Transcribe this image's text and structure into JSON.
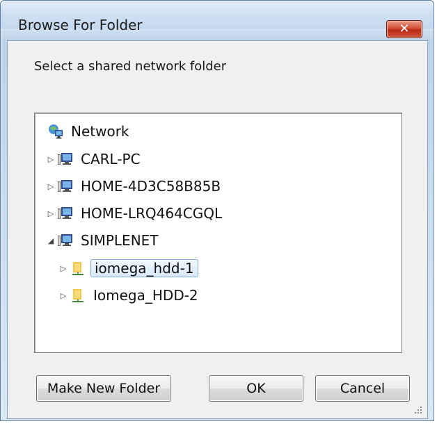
{
  "window": {
    "title": "Browse For Folder",
    "close_glyph": "✕"
  },
  "dialog": {
    "prompt": "Select a shared network folder"
  },
  "tree": {
    "root": {
      "label": "Network",
      "icon": "network-globe-icon"
    },
    "items": [
      {
        "label": "CARL-PC",
        "expander": "▷",
        "icon": "computer-icon"
      },
      {
        "label": "HOME-4D3C58B85B",
        "expander": "▷",
        "icon": "computer-icon"
      },
      {
        "label": "HOME-LRQ464CGQL",
        "expander": "▷",
        "icon": "computer-icon"
      },
      {
        "label": "SIMPLENET",
        "expander": "◢",
        "icon": "computer-icon",
        "expanded": true
      }
    ],
    "children": [
      {
        "label": "iomega_hdd-1",
        "expander": "▷",
        "icon": "shared-folder-icon",
        "selected": true
      },
      {
        "label": "Iomega_HDD-2",
        "expander": "▷",
        "icon": "shared-folder-icon"
      }
    ]
  },
  "buttons": {
    "make_new_folder": "Make New Folder",
    "ok": "OK",
    "cancel": "Cancel"
  },
  "colors": {
    "title_gradient_top": "#e1ecf9",
    "title_gradient_bottom": "#c3d8ef",
    "close_red": "#c63a22",
    "selection_border": "#84acdd"
  }
}
